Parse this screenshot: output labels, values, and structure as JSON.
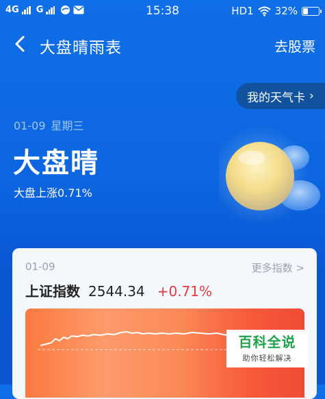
{
  "status_bar": {
    "network1": "4G",
    "network2": "G",
    "time": "15:38",
    "hd": "HD1",
    "battery": "32%",
    "battery_level": 0.32
  },
  "header": {
    "title": "大盘晴雨表",
    "right_link": "去股票"
  },
  "weather_card_button": "我的天气卡",
  "date": {
    "day": "01-09",
    "weekday": "星期三"
  },
  "market_status": "大盘晴",
  "market_desc": "大盘上涨0.71%",
  "index_card": {
    "date": "01-09",
    "more_link": "更多指数 >",
    "name": "上证指数",
    "value": "2544.34",
    "change": "+0.71%"
  },
  "watermark": {
    "main": "百科全说",
    "sub": "助你轻松解决"
  },
  "colors": {
    "accent_red": "#e8383d",
    "brand_green": "#1fa34a",
    "bg_blue": "#0d66e0"
  }
}
